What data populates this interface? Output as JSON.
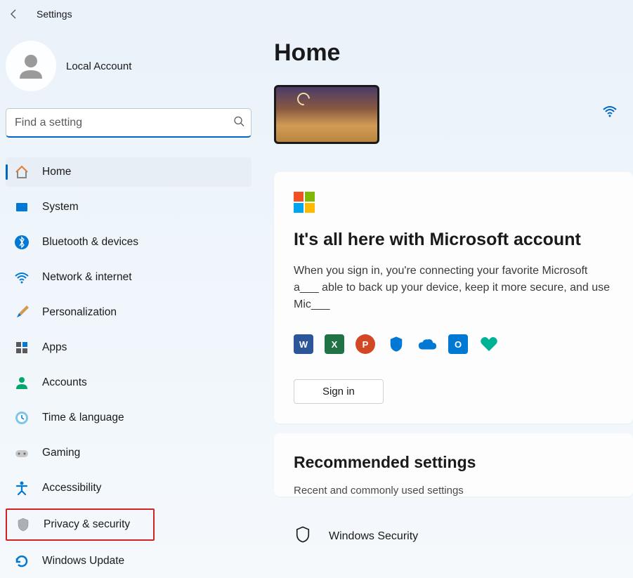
{
  "titlebar": {
    "title": "Settings"
  },
  "profile": {
    "name": "Local Account"
  },
  "search": {
    "placeholder": "Find a setting"
  },
  "sidebar": {
    "items": [
      {
        "id": "home",
        "label": "Home",
        "selected": true
      },
      {
        "id": "system",
        "label": "System"
      },
      {
        "id": "bluetooth",
        "label": "Bluetooth & devices"
      },
      {
        "id": "network",
        "label": "Network & internet"
      },
      {
        "id": "personalization",
        "label": "Personalization"
      },
      {
        "id": "apps",
        "label": "Apps"
      },
      {
        "id": "accounts",
        "label": "Accounts"
      },
      {
        "id": "time",
        "label": "Time & language"
      },
      {
        "id": "gaming",
        "label": "Gaming"
      },
      {
        "id": "accessibility",
        "label": "Accessibility"
      },
      {
        "id": "privacy",
        "label": "Privacy & security",
        "highlighted": true
      },
      {
        "id": "update",
        "label": "Windows Update"
      }
    ]
  },
  "main": {
    "title": "Home",
    "msCard": {
      "heading": "It's all here with Microsoft account",
      "body": "When you sign in, you're connecting your favorite Microsoft a___ able to back up your device, keep it more secure, and use Mic___",
      "signInLabel": "Sign in"
    },
    "recommended": {
      "heading": "Recommended settings",
      "subtitle": "Recent and commonly used settings",
      "rows": [
        {
          "label": "Windows Security"
        }
      ]
    }
  }
}
